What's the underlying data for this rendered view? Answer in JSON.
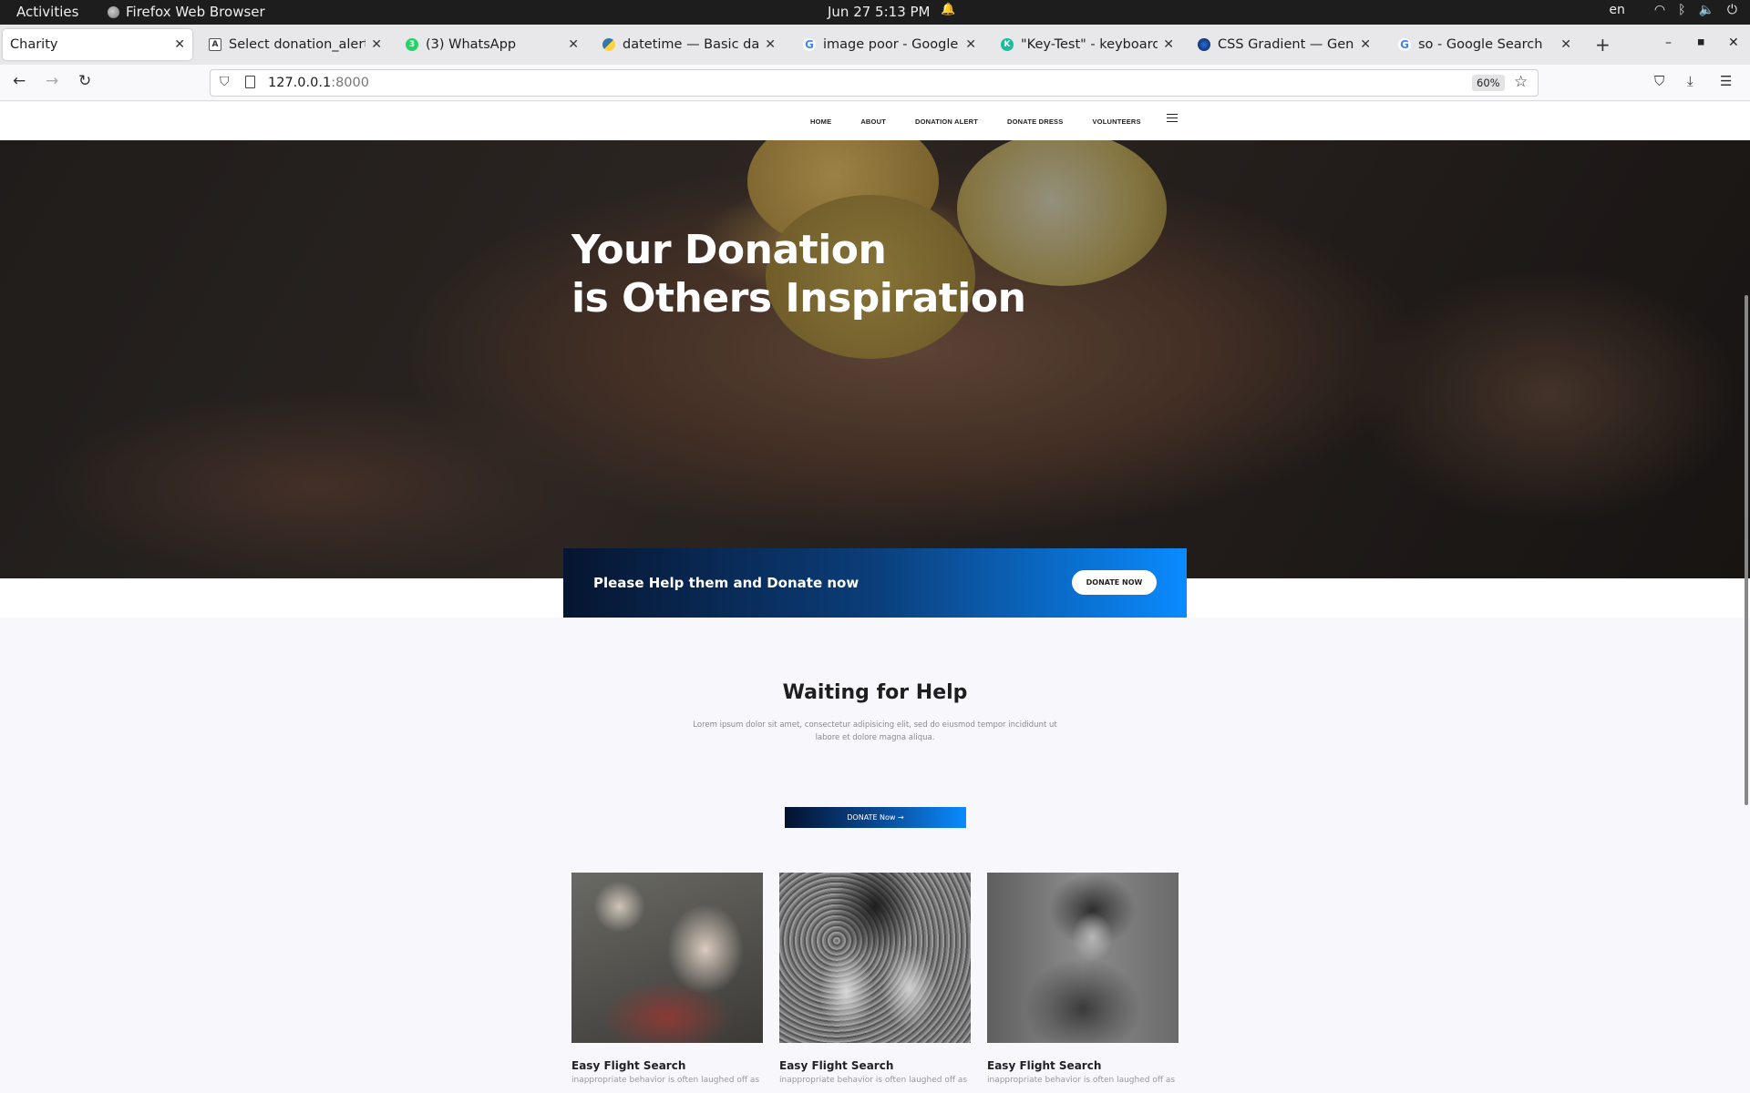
{
  "os": {
    "activities": "Activities",
    "app_name": "Firefox Web Browser",
    "clock": "Jun 27  5:13 PM",
    "language": "en"
  },
  "tabs": [
    {
      "title": "Charity",
      "favicon": "none",
      "active": true
    },
    {
      "title": "Select donation_alert to",
      "favicon": "django-icon",
      "active": false
    },
    {
      "title": "(3) WhatsApp",
      "favicon": "whatsapp-icon",
      "active": false
    },
    {
      "title": "datetime — Basic date a",
      "favicon": "python-icon",
      "active": false
    },
    {
      "title": "image poor - Google Sea",
      "favicon": "google-icon",
      "active": false
    },
    {
      "title": "\"Key-Test\" - keyboard te",
      "favicon": "keytest-icon",
      "active": false
    },
    {
      "title": "CSS Gradient — Generat",
      "favicon": "cssgradient-icon",
      "active": false
    },
    {
      "title": "so - Google Search",
      "favicon": "google-icon",
      "active": false
    }
  ],
  "address": {
    "host": "127.0.0.1",
    "port": ":8000",
    "zoom": "60%"
  },
  "site": {
    "nav": [
      "HOME",
      "ABOUT",
      "DONATION ALERT",
      "DONATE DRESS",
      "VOLUNTEERS"
    ],
    "hero_line1": "Your Donation",
    "hero_line2": "is Others Inspiration",
    "cta_text": "Please Help them and Donate now",
    "cta_button": "DONATE NOW",
    "section_title": "Waiting for Help",
    "section_sub": "Lorem ipsum dolor sit amet, consectetur adipisicing elit, sed do eiusmod tempor incididunt ut labore et dolore magna aliqua.",
    "donate_button": "DONATE Now →",
    "cards": [
      {
        "title": "Easy Flight Search",
        "text": "inappropriate behavior is often laughed off as"
      },
      {
        "title": "Easy Flight Search",
        "text": "inappropriate behavior is often laughed off as"
      },
      {
        "title": "Easy Flight Search",
        "text": "inappropriate behavior is often laughed off as"
      }
    ]
  },
  "colors": {
    "cta_gradient_start": "#061530",
    "cta_gradient_end": "#0a8bff"
  }
}
